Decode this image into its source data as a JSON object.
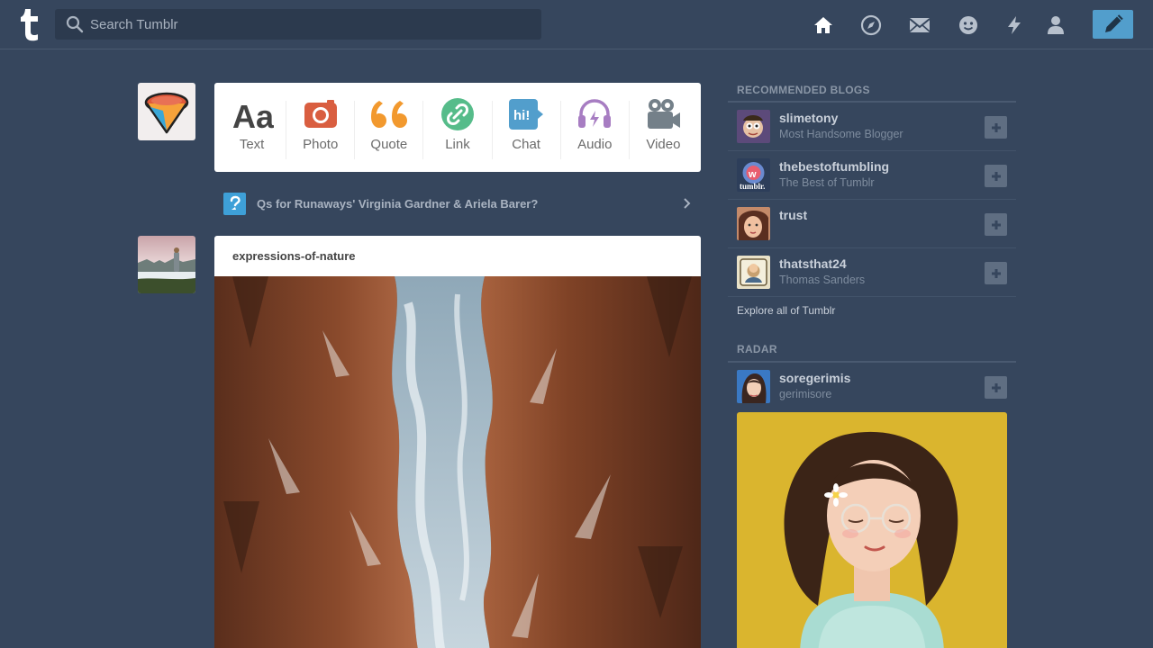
{
  "header": {
    "search_placeholder": "Search Tumblr",
    "nav_icons": [
      "home-icon",
      "explore-icon",
      "inbox-icon",
      "messaging-icon",
      "activity-icon",
      "account-icon"
    ],
    "compose_icon": "pencil-icon",
    "accent_color": "#529ecc",
    "background_color": "#36465d"
  },
  "post_types": [
    {
      "label": "Text",
      "icon": "text-icon",
      "color": "#444444"
    },
    {
      "label": "Photo",
      "icon": "camera-icon",
      "color": "#d95e40"
    },
    {
      "label": "Quote",
      "icon": "quote-icon",
      "color": "#f2992e"
    },
    {
      "label": "Link",
      "icon": "link-icon",
      "color": "#56bc8a"
    },
    {
      "label": "Chat",
      "icon": "chat-icon",
      "color": "#529ecc"
    },
    {
      "label": "Audio",
      "icon": "headphones-icon",
      "color": "#a77dc2"
    },
    {
      "label": "Video",
      "icon": "video-camera-icon",
      "color": "#748089"
    }
  ],
  "question_banner": {
    "text": "Qs for Runaways' Virginia Gardner & Ariela Barer?"
  },
  "post": {
    "blog_name": "expressions-of-nature"
  },
  "sidebar": {
    "recommended_title": "RECOMMENDED BLOGS",
    "recommended": [
      {
        "name": "slimetony",
        "subtitle": "Most Handsome Blogger"
      },
      {
        "name": "thebestoftumbling",
        "subtitle": "The Best of Tumblr"
      },
      {
        "name": "trust",
        "subtitle": ""
      },
      {
        "name": "thatsthat24",
        "subtitle": "Thomas Sanders"
      }
    ],
    "explore_link": "Explore all of Tumblr",
    "radar_title": "RADAR",
    "radar": {
      "name": "soregerimis",
      "subtitle": "gerimisore"
    }
  }
}
